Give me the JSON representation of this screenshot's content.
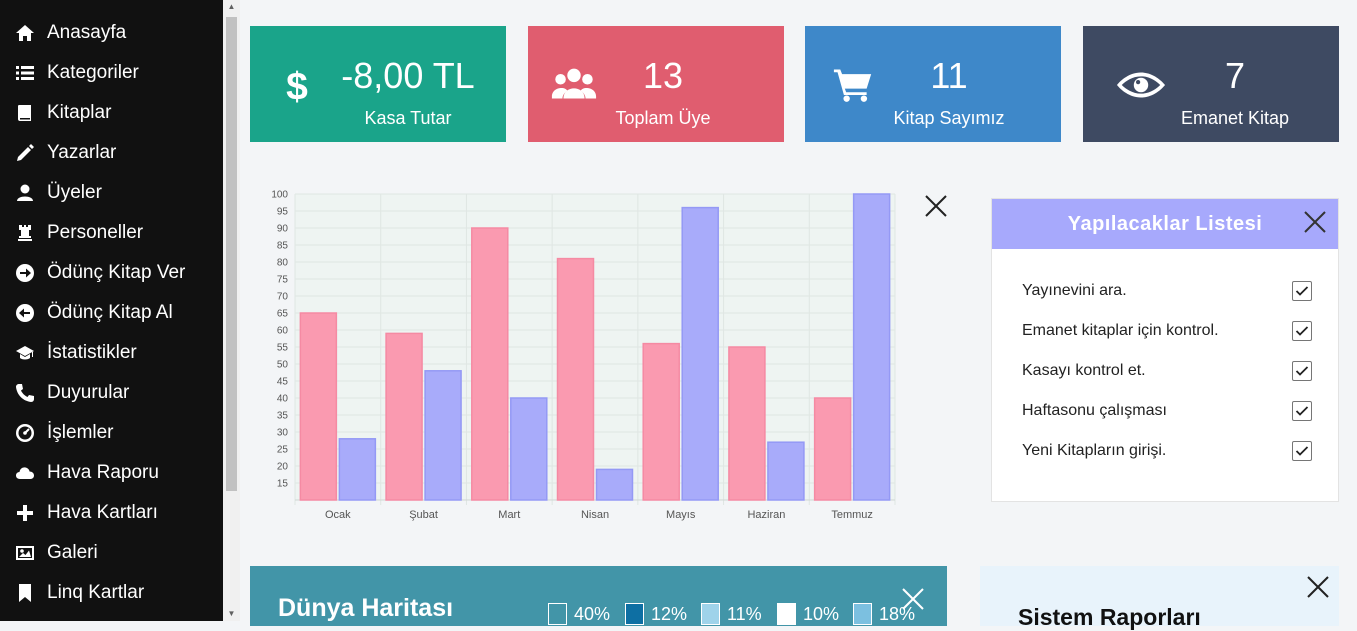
{
  "sidebar": {
    "items": [
      {
        "label": "Anasayfa",
        "icon": "home-icon"
      },
      {
        "label": "Kategoriler",
        "icon": "list-icon"
      },
      {
        "label": "Kitaplar",
        "icon": "book-icon"
      },
      {
        "label": "Yazarlar",
        "icon": "pencil-icon"
      },
      {
        "label": "Üyeler",
        "icon": "user-icon"
      },
      {
        "label": "Personeller",
        "icon": "chess-rook-icon"
      },
      {
        "label": "Ödünç Kitap Ver",
        "icon": "circle-arrow-right-icon"
      },
      {
        "label": "Ödünç Kitap Al",
        "icon": "circle-arrow-left-icon"
      },
      {
        "label": "İstatistikler",
        "icon": "graduation-cap-icon"
      },
      {
        "label": "Duyurular",
        "icon": "phone-icon"
      },
      {
        "label": "İşlemler",
        "icon": "dashboard-icon"
      },
      {
        "label": "Hava Raporu",
        "icon": "cloud-icon"
      },
      {
        "label": "Hava Kartları",
        "icon": "plus-icon"
      },
      {
        "label": "Galeri",
        "icon": "image-icon"
      },
      {
        "label": "Linq Kartlar",
        "icon": "bookmark-icon"
      }
    ]
  },
  "stats": [
    {
      "value": "-8,00 TL",
      "label": "Kasa Tutar",
      "icon": "dollar-icon",
      "color": "#1aa48a"
    },
    {
      "value": "13",
      "label": "Toplam Üye",
      "icon": "users-icon",
      "color": "#e05d6f"
    },
    {
      "value": "11",
      "label": "Kitap Sayımız",
      "icon": "shopping-cart-icon",
      "color": "#3e88c9"
    },
    {
      "value": "7",
      "label": "Emanet Kitap",
      "icon": "eye-icon",
      "color": "#3e4a62"
    }
  ],
  "chart_data": {
    "type": "bar",
    "categories": [
      "Ocak",
      "Şubat",
      "Mart",
      "Nisan",
      "Mayıs",
      "Haziran",
      "Temmuz"
    ],
    "series": [
      {
        "values": [
          65,
          59,
          90,
          81,
          56,
          55,
          40
        ],
        "color": "#fa9ab0"
      },
      {
        "values": [
          28,
          48,
          40,
          19,
          96,
          27,
          100
        ],
        "color": "#a8abfa"
      }
    ],
    "yticks": [
      15,
      20,
      25,
      30,
      35,
      40,
      45,
      50,
      55,
      60,
      65,
      70,
      75,
      80,
      85,
      90,
      95,
      100
    ],
    "ylim": [
      10,
      100
    ],
    "grid": true,
    "legend": "none"
  },
  "todo": {
    "title": "Yapılacaklar Listesi",
    "items": [
      {
        "text": "Yayınevini ara.",
        "checked": true
      },
      {
        "text": "Emanet kitaplar için kontrol.",
        "checked": true
      },
      {
        "text": "Kasayı kontrol et.",
        "checked": true
      },
      {
        "text": "Haftasonu çalışması",
        "checked": true
      },
      {
        "text": "Yeni Kitapların girişi.",
        "checked": true
      }
    ]
  },
  "map": {
    "title": "Dünya Haritası",
    "legend": [
      {
        "label": "40%",
        "color": "#4295a8"
      },
      {
        "label": "12%",
        "color": "#0e6fa3"
      },
      {
        "label": "11%",
        "color": "#9fd3ea"
      },
      {
        "label": "10%",
        "color": "#ffffff"
      },
      {
        "label": "18%",
        "color": "#7cc0e0"
      }
    ]
  },
  "reports": {
    "title": "Sistem Raporları"
  }
}
